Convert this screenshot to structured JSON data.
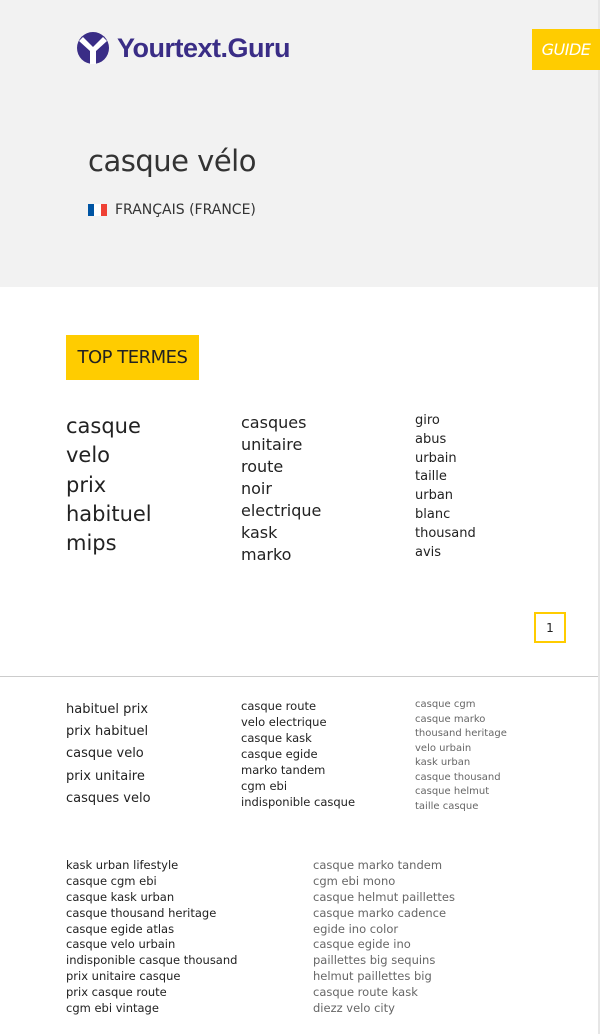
{
  "header": {
    "brand": "Yourtext.Guru",
    "guide_label": "GUIDE",
    "keyword": "casque vélo",
    "language": "FRANÇAIS (FRANCE)",
    "flag_colors": [
      "#0055a4",
      "#ffffff",
      "#ef4135"
    ]
  },
  "top_terms": {
    "label": "TOP TERMES",
    "col1": [
      "casque",
      "velo",
      "prix",
      "habituel",
      "mips"
    ],
    "col2": [
      "casques",
      "unitaire",
      "route",
      "noir",
      "electrique",
      "kask",
      "marko"
    ],
    "col3": [
      "giro",
      "abus",
      "urbain",
      "taille",
      "urban",
      "blanc",
      "thousand",
      "avis"
    ],
    "page": "1"
  },
  "phrases": {
    "col1": [
      "habituel prix",
      "prix habituel",
      "casque velo",
      "prix unitaire",
      "casques velo"
    ],
    "col2": [
      "casque route",
      "velo electrique",
      "casque kask",
      "casque egide",
      "marko tandem",
      "cgm ebi",
      "indisponible casque"
    ],
    "col3": [
      "casque cgm",
      "casque marko",
      "thousand heritage",
      "velo urbain",
      "kask urban",
      "casque thousand",
      "casque helmut",
      "taille casque"
    ]
  },
  "long_phrases": {
    "col1": [
      "kask urban lifestyle",
      "casque cgm ebi",
      "casque kask urban",
      "casque thousand heritage",
      "casque egide atlas",
      "casque velo urbain",
      "indisponible casque thousand",
      "prix unitaire casque",
      "prix casque route",
      "cgm ebi vintage"
    ],
    "col2": [
      "casque marko tandem",
      "cgm ebi mono",
      "casque helmut paillettes",
      "casque marko cadence",
      "egide ino color",
      "casque egide ino",
      "paillettes big sequins",
      "helmut paillettes big",
      "casque route kask",
      "diezz velo city"
    ]
  },
  "colors": {
    "accent": "#ffcc00",
    "brand": "#3a2d86",
    "header_bg": "#f2f2f2"
  }
}
